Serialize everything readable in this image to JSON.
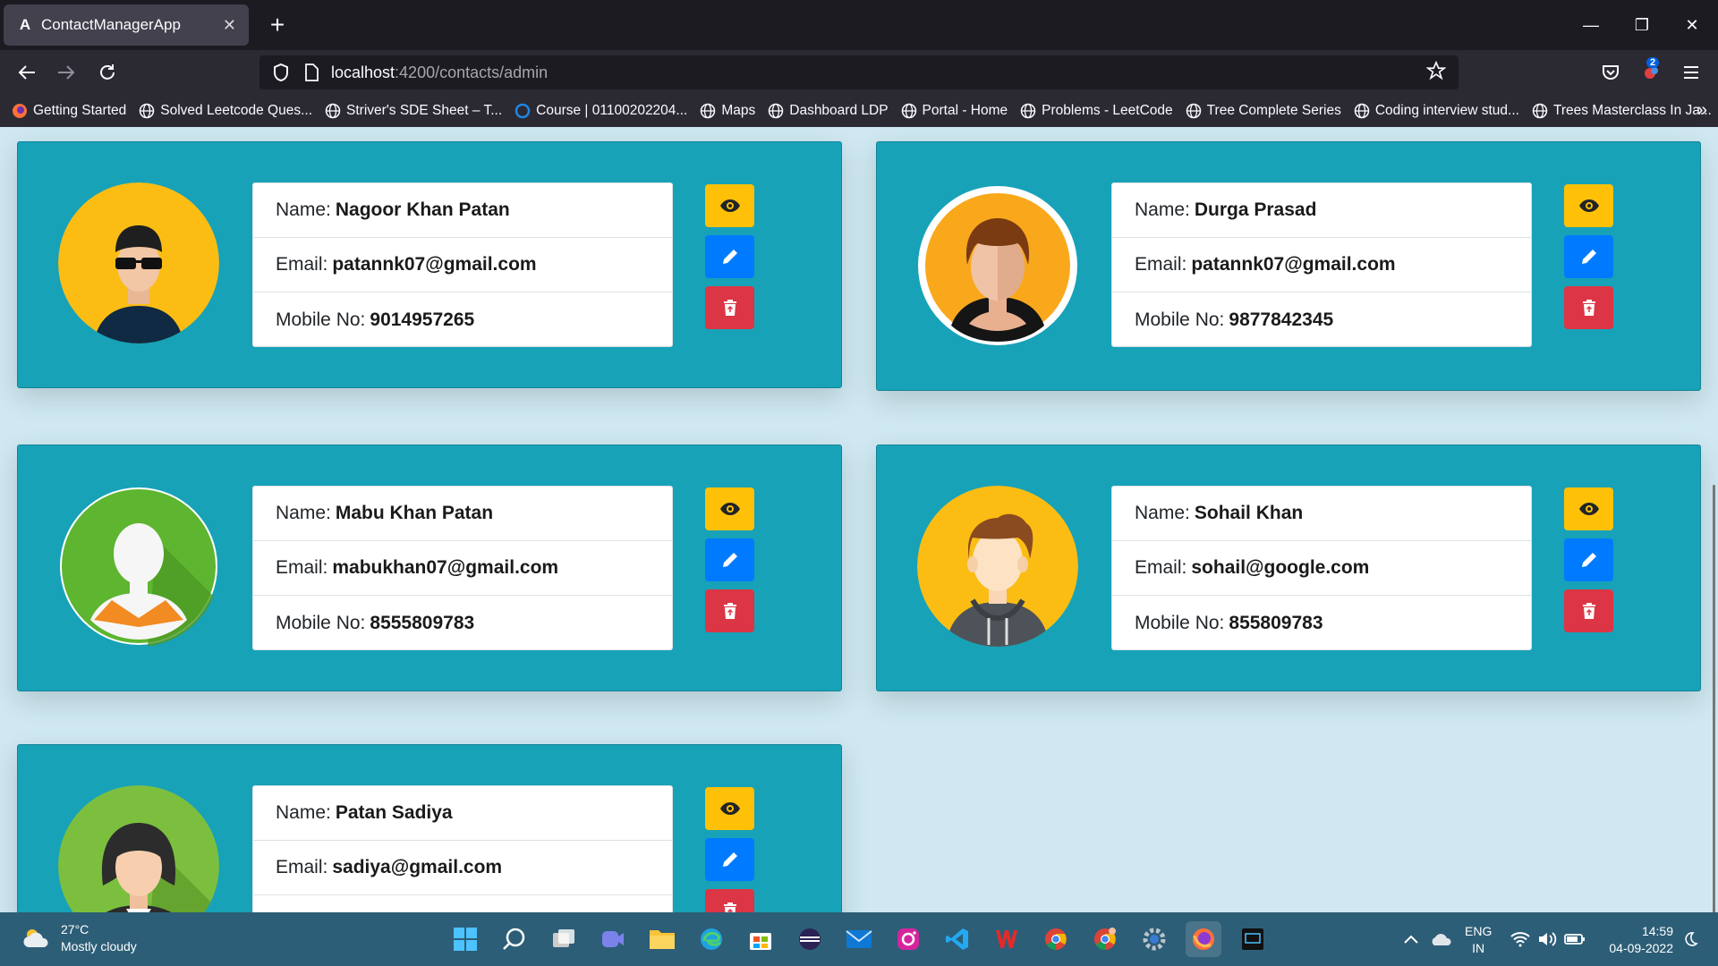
{
  "browser": {
    "tab_title": "ContactManagerApp",
    "url_host": "localhost",
    "url_path": ":4200/contacts/admin",
    "extension_badge": "2",
    "bookmarks": [
      "Getting Started",
      "Solved Leetcode Ques...",
      "Striver's SDE Sheet – T...",
      "Course | 01100202204...",
      "Maps",
      "Dashboard LDP",
      "Portal - Home",
      "Problems - LeetCode",
      "Tree Complete Series",
      "Coding interview stud...",
      "Trees Masterclass In Ja..."
    ]
  },
  "labels": {
    "name": "Name:",
    "email": "Email:",
    "mobile": "Mobile No:"
  },
  "contacts": [
    {
      "name": "Nagoor Khan Patan",
      "email": "patannk07@gmail.com",
      "mobile": "9014957265"
    },
    {
      "name": "Durga Prasad",
      "email": "patannk07@gmail.com",
      "mobile": "9877842345"
    },
    {
      "name": "Mabu Khan Patan",
      "email": "mabukhan07@gmail.com",
      "mobile": "8555809783"
    },
    {
      "name": "Sohail Khan",
      "email": "sohail@google.com",
      "mobile": "855809783"
    },
    {
      "name": "Patan Sadiya",
      "email": "sadiya@gmail.com",
      "mobile": ""
    }
  ],
  "colors": {
    "card": "#17a2b8",
    "view": "#ffc107",
    "edit": "#007bff",
    "delete": "#dc3545"
  },
  "taskbar": {
    "temperature": "27°C",
    "weather": "Mostly cloudy",
    "lang1": "ENG",
    "lang2": "IN",
    "time": "14:59",
    "date": "04-09-2022"
  }
}
